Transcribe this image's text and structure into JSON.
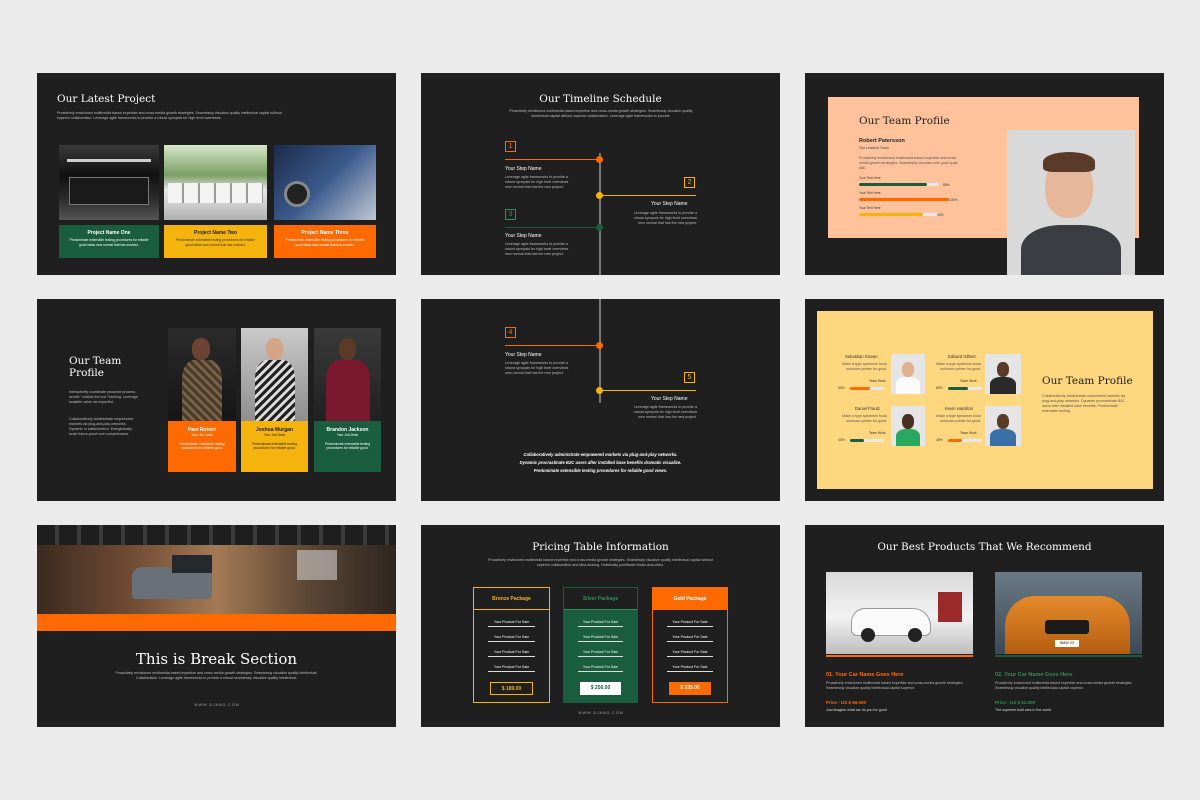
{
  "s1": {
    "title": "Our Latest Project",
    "desc": "Proactively envisioned multimedia based expertise and cross-media growth strategies. Seamlessly visualize quality intellectual capital without superior collaboration. Leverage agile frameworks to provide a robust synopsis for high level overviews.",
    "cards": [
      {
        "title": "Project Name One",
        "text": "Predominate extensible testing procedures for reliable good ideas new normal that has evolved."
      },
      {
        "title": "Project Name Two",
        "text": "Predominate extensible testing procedures for reliable good ideas new normal that has evolved."
      },
      {
        "title": "Project Name Three",
        "text": "Predominate extensible testing procedures for reliable good ideas new normal that has evolved."
      }
    ]
  },
  "s2": {
    "title": "Our Timeline Schedule",
    "desc": "Proactively envisioned multimedia based expertise and cross-media growth strategies. Seamlessly visualize quality intellectual capital without superior collaboration. Leverage agile frameworks to provide.",
    "steps": [
      {
        "num": "1",
        "title": "Your Step Name",
        "text": "Leverage agile frameworks to provide a robust synopsis for high level overviews new normal that has the new project."
      },
      {
        "num": "2",
        "title": "Your Step Name",
        "text": "Leverage agile frameworks to provide a robust synopsis for high level overviews new normal that has the new project."
      },
      {
        "num": "3",
        "title": "Your Step Name",
        "text": "Leverage agile frameworks to provide a robust synopsis for high level overviews new normal that has the new project."
      }
    ]
  },
  "s3": {
    "title": "Our Team Profile",
    "name": "Robert Patersson",
    "role": "Our Leaders Team",
    "desc": "Proactively envisioned multimedia based expertise and cross-media growth strategies. Seamlessly visualize with good quali skill.",
    "skills": [
      {
        "label": "Your Text Here",
        "pct": "85%",
        "value": 0.85
      },
      {
        "label": "Your Text Here",
        "pct": "100%",
        "value": 1.0
      },
      {
        "label": "Your Text Here",
        "pct": "80%",
        "value": 0.8
      }
    ],
    "colors": [
      "#1b5e3f",
      "#ff6a00",
      "#f5b30e"
    ]
  },
  "s4": {
    "title": "Our Team Profile",
    "desc1": "Interactively coordinate proactive process centric \"outside the box\" thinking. Leverage scalable value via impactful.",
    "desc2": "Collaboratively administrate empowered markets via plug-and-play networks. Dynamic in sales/metrics. Energistically scale future-proof core competencies.",
    "members": [
      {
        "name": "Paul Robert",
        "role": "Your Job Desk",
        "text": "Predominate extensible testing procedures for reliable good."
      },
      {
        "name": "Joshua Murgan",
        "role": "Your Job Desk",
        "text": "Predominate extensible testing procedures for reliable good."
      },
      {
        "name": "Brandon Jackson",
        "role": "Your Job Desk",
        "text": "Predominate extensible testing procedures for reliable good."
      }
    ]
  },
  "s5": {
    "steps": [
      {
        "num": "4",
        "title": "Your Step Name",
        "text": "Leverage agile frameworks to provide a robust synopsis for high level overviews new normal that has the new project."
      },
      {
        "num": "5",
        "title": "Your Step Name",
        "text": "Leverage agile frameworks to provide a robust synopsis for high level overviews new normal that has the new project."
      }
    ],
    "quote": [
      "Collaboratively administrate empowered markets via plug-and-play networks.",
      "Dynamic procrastinate B2C users after installed base benefits dramatic visualize.",
      "Predominate extensible testing procedures for reliable good views."
    ]
  },
  "s6": {
    "title": "Our Team Profile",
    "desc": "Collaboratively administrate empowered markets via plug-and-play networks. Dynamic procrastinate B2C users after installed base benefits. Predominate extensible testing.",
    "members": [
      {
        "name": "Sebastian Klavan",
        "text": "Make a type specimen book unknown printer for good.",
        "label": "Team Work",
        "pct": "60%",
        "value": 0.6
      },
      {
        "name": "Edward Gilbert",
        "text": "Make a type specimen book unknown printer for good.",
        "label": "Team Work",
        "pct": "60%",
        "value": 0.6
      },
      {
        "name": "Daniel Frautz",
        "text": "Make a type specimen book unknown printer for good.",
        "label": "Team Work",
        "pct": "40%",
        "value": 0.4
      },
      {
        "name": "Kevin Hamilton",
        "text": "Make a type specimen book unknown printer for good.",
        "label": "Team Work",
        "pct": "40%",
        "value": 0.4
      }
    ]
  },
  "s7": {
    "title": "This is Break Section",
    "desc": "Proactively envisioned multimedia based expertise and cross-media growth strategies. Seamlessly visualize quality intellectual. Collaboration. Leverage agile frameworks to provide a robust seamlessly visualize quality intellectual.",
    "url": "W W W . D J A N G . C O M"
  },
  "s8": {
    "title": "Pricing Table Information",
    "desc": "Proactively envisioned multimedia based expertise and cross-media growth strategies. Seamlessly visualize quality intellectual capital without superior collaboration and idea-sharing. Holistically pontificate bricks-and-clicks.",
    "packages": [
      {
        "name": "Bronze Package",
        "items": [
          "Your Product For Sale",
          "Your Product For Sale",
          "Your Product For Sale",
          "Your Product For Sale"
        ],
        "price": "$ 189.00"
      },
      {
        "name": "Silver Package",
        "items": [
          "Your Product For Sale",
          "Your Product For Sale",
          "Your Product For Sale",
          "Your Product For Sale"
        ],
        "price": "$ 256.00"
      },
      {
        "name": "Gold Package",
        "items": [
          "Your Product For Sale",
          "Your Product For Sale",
          "Your Product For Sale",
          "Your Product For Sale"
        ],
        "price": "$ 335.00"
      }
    ],
    "url": "W W W . D J A N G . C O M"
  },
  "s9": {
    "title": "Our Best Products That We Recommend",
    "products": [
      {
        "title": "01. Your Car Name Goes Here",
        "text": "Proactively envisioned multimedia based expertise and cross-media growth strategies. Seamlessly visualize quality intellectual capital superior.",
        "price": "Price : US $ 69.000",
        "tag": "Just imagine what car do you for good"
      },
      {
        "title": "02. Your Car Name Goes Here",
        "text": "Proactively envisioned multimedia based expertise and cross-media growth strategies. Seamlessly visualize quality intellectual capital superior.",
        "price": "Price : US $ 62.000",
        "tag": "The supreme built cars in the world"
      }
    ],
    "plate": "BMW X3"
  }
}
